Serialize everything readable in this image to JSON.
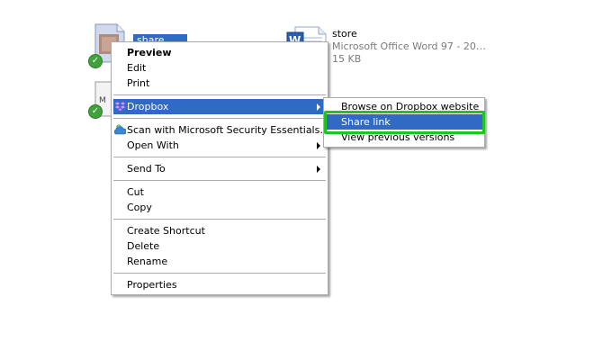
{
  "desktop": {
    "file1": {
      "label": "share"
    },
    "file2": {
      "name": "store",
      "type": "Microsoft Office Word 97 - 20…",
      "size": "15 KB"
    }
  },
  "context_menu": {
    "items": [
      {
        "label": "Preview"
      },
      {
        "label": "Edit"
      },
      {
        "label": "Print"
      },
      {
        "label": "Dropbox"
      },
      {
        "label": "Scan with Microsoft Security Essentials…"
      },
      {
        "label": "Open With"
      },
      {
        "label": "Send To"
      },
      {
        "label": "Cut"
      },
      {
        "label": "Copy"
      },
      {
        "label": "Create Shortcut"
      },
      {
        "label": "Delete"
      },
      {
        "label": "Rename"
      },
      {
        "label": "Properties"
      }
    ]
  },
  "dropbox_submenu": {
    "items": [
      {
        "label": "Browse on Dropbox website"
      },
      {
        "label": "Share link"
      },
      {
        "label": "View previous versions"
      }
    ]
  },
  "colors": {
    "highlight": "#316ac5",
    "callout_green": "#21c41f",
    "menu_border": "#acabab"
  }
}
